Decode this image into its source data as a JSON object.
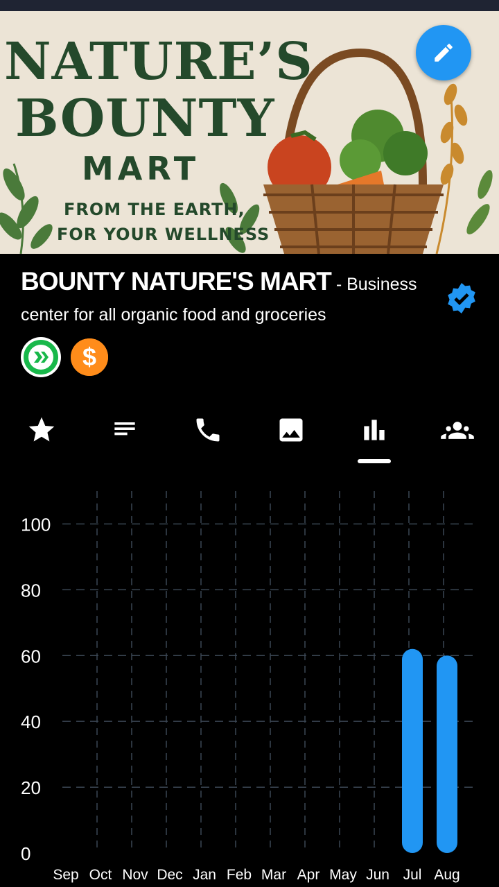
{
  "banner": {
    "line1": "NATURE’S",
    "line2": "BOUNTY",
    "line3": "MART",
    "tagline1": "FROM THE EARTH,",
    "tagline2": "FOR YOUR WELLNESS",
    "edit_icon": "pencil-icon"
  },
  "profile": {
    "name": "BOUNTY NATURE'S MART",
    "description": " - Business center for all organic food and groceries",
    "verified_icon": "verified-badge-icon",
    "tokens": [
      {
        "name": "hive-token-icon",
        "color": "#18b84a"
      },
      {
        "name": "hbd-token-icon",
        "color": "#ff8c1a"
      }
    ]
  },
  "tabs": [
    {
      "icon": "star-icon"
    },
    {
      "icon": "notes-icon"
    },
    {
      "icon": "phone-icon"
    },
    {
      "icon": "image-icon"
    },
    {
      "icon": "bar-chart-icon",
      "active": true
    },
    {
      "icon": "group-icon"
    }
  ],
  "colors": {
    "accent": "#2196f3",
    "background": "#000000",
    "grid": "#3b4754"
  },
  "chart_data": {
    "type": "bar",
    "categories": [
      "Sep",
      "Oct",
      "Nov",
      "Dec",
      "Jan",
      "Feb",
      "Mar",
      "Apr",
      "May",
      "Jun",
      "Jul",
      "Aug"
    ],
    "values": [
      0,
      0,
      0,
      0,
      0,
      0,
      0,
      0,
      0,
      0,
      62,
      60
    ],
    "yticks": [
      "0",
      "20",
      "40",
      "60",
      "80",
      "100"
    ],
    "ylim": [
      0,
      110
    ],
    "grid": true
  }
}
